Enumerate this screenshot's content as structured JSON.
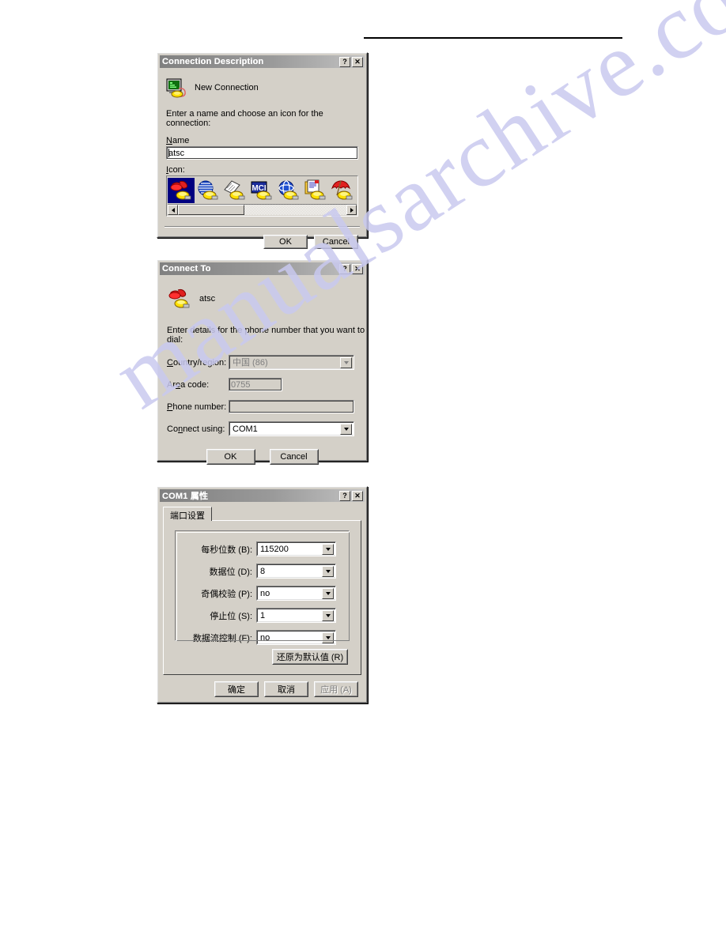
{
  "watermark": {
    "text": "manualsarchive.com"
  },
  "dialogs": {
    "connection_description": {
      "title": "Connection Description",
      "help_button": "?",
      "close_button": "✕",
      "header_label": "New Connection",
      "prompt": "Enter a name and choose an icon for the connection:",
      "name_label": "Name",
      "name_value": "atsc",
      "icon_label": "Icon:",
      "icons": [
        {
          "name": "red-phones-icon",
          "selected": true
        },
        {
          "name": "blue-globe-icon",
          "selected": false
        },
        {
          "name": "notes-pages-icon",
          "selected": false
        },
        {
          "name": "mci-logo-icon",
          "selected": false
        },
        {
          "name": "blue-atom-globe-icon",
          "selected": false
        },
        {
          "name": "document-list-icon",
          "selected": false
        },
        {
          "name": "red-umbrella-icon",
          "selected": false
        }
      ],
      "buttons": {
        "ok": "OK",
        "cancel": "Cancel"
      }
    },
    "connect_to": {
      "title": "Connect To",
      "help_button": "?",
      "close_button": "✕",
      "header_label": "atsc",
      "prompt": "Enter details for the phone number that you want to dial:",
      "fields": [
        {
          "label": "Country/region:",
          "value": "中国 (86)",
          "type": "combo",
          "disabled": true
        },
        {
          "label": "Area code:",
          "value": "0755",
          "type": "text",
          "disabled": true
        },
        {
          "label": "Phone number:",
          "value": "",
          "type": "text",
          "disabled": true
        },
        {
          "label": "Connect using:",
          "value": "COM1",
          "type": "combo",
          "disabled": false
        }
      ],
      "buttons": {
        "ok": "OK",
        "cancel": "Cancel"
      }
    },
    "com1_properties": {
      "title": "COM1 属性",
      "help_button": "?",
      "close_button": "✕",
      "tab_label": "端口设置",
      "settings": [
        {
          "label": "每秒位数 (B):",
          "value": "115200"
        },
        {
          "label": "数据位 (D):",
          "value": "8"
        },
        {
          "label": "奇偶校验 (P):",
          "value": "no"
        },
        {
          "label": "停止位 (S):",
          "value": "1"
        },
        {
          "label": "数据流控制 (F):",
          "value": "no"
        }
      ],
      "restore_button": "还原为默认值 (R)",
      "buttons": {
        "ok": "确定",
        "cancel": "取消",
        "apply": "应用 (A)",
        "apply_disabled": true
      }
    }
  }
}
